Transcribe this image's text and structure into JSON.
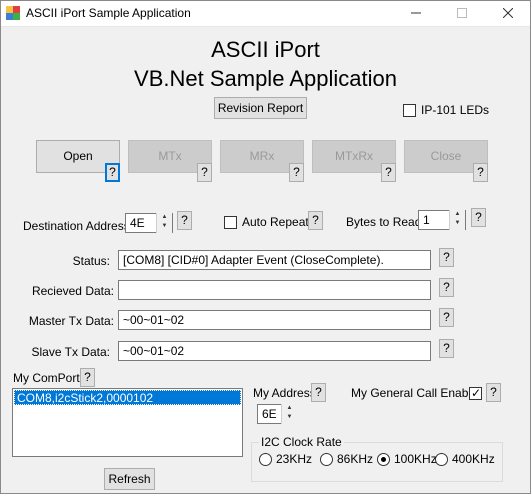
{
  "window": {
    "title": "ASCII iPort Sample Application",
    "minimize_icon": "minimize-icon",
    "maximize_icon": "maximize-icon",
    "close_icon": "close-icon"
  },
  "header": {
    "line1": "ASCII iPort",
    "line2": "VB.Net Sample Application"
  },
  "revision_button": "Revision Report",
  "ip101_leds": {
    "label": "IP-101 LEDs",
    "checked": false
  },
  "actions": {
    "open": "Open",
    "mtx": "MTx",
    "mrx": "MRx",
    "mtxrx": "MTxRx",
    "close": "Close"
  },
  "help_glyph": "?",
  "destination_address": {
    "label": "Destination Address",
    "value": "4E"
  },
  "auto_repeat": {
    "label": "Auto Repeat",
    "checked": false
  },
  "bytes_to_read": {
    "label": "Bytes to Read",
    "value": "1"
  },
  "status": {
    "label": "Status:",
    "value": "[COM8] [CID#0] Adapter Event (CloseComplete)."
  },
  "received_data": {
    "label": "Recieved Data:",
    "value": ""
  },
  "master_tx": {
    "label": "Master Tx Data:",
    "value": "~00~01~02"
  },
  "slave_tx": {
    "label": "Slave Tx Data:",
    "value": "~00~01~02"
  },
  "my_comport": {
    "label": "My ComPort",
    "items": [
      "COM8,i2cStick2,0000102"
    ],
    "selected": 0
  },
  "refresh_button": "Refresh",
  "my_address": {
    "label": "My Address",
    "value": "6E"
  },
  "general_call": {
    "label": "My General Call Enable",
    "checked": true
  },
  "i2c_clock": {
    "title": "I2C Clock Rate",
    "options": [
      "23KHz",
      "86KHz",
      "100KHz",
      "400KHz"
    ],
    "selected": "100KHz"
  },
  "colors": {
    "selection": "#0078d7",
    "window_bg": "#f0f0f0"
  }
}
